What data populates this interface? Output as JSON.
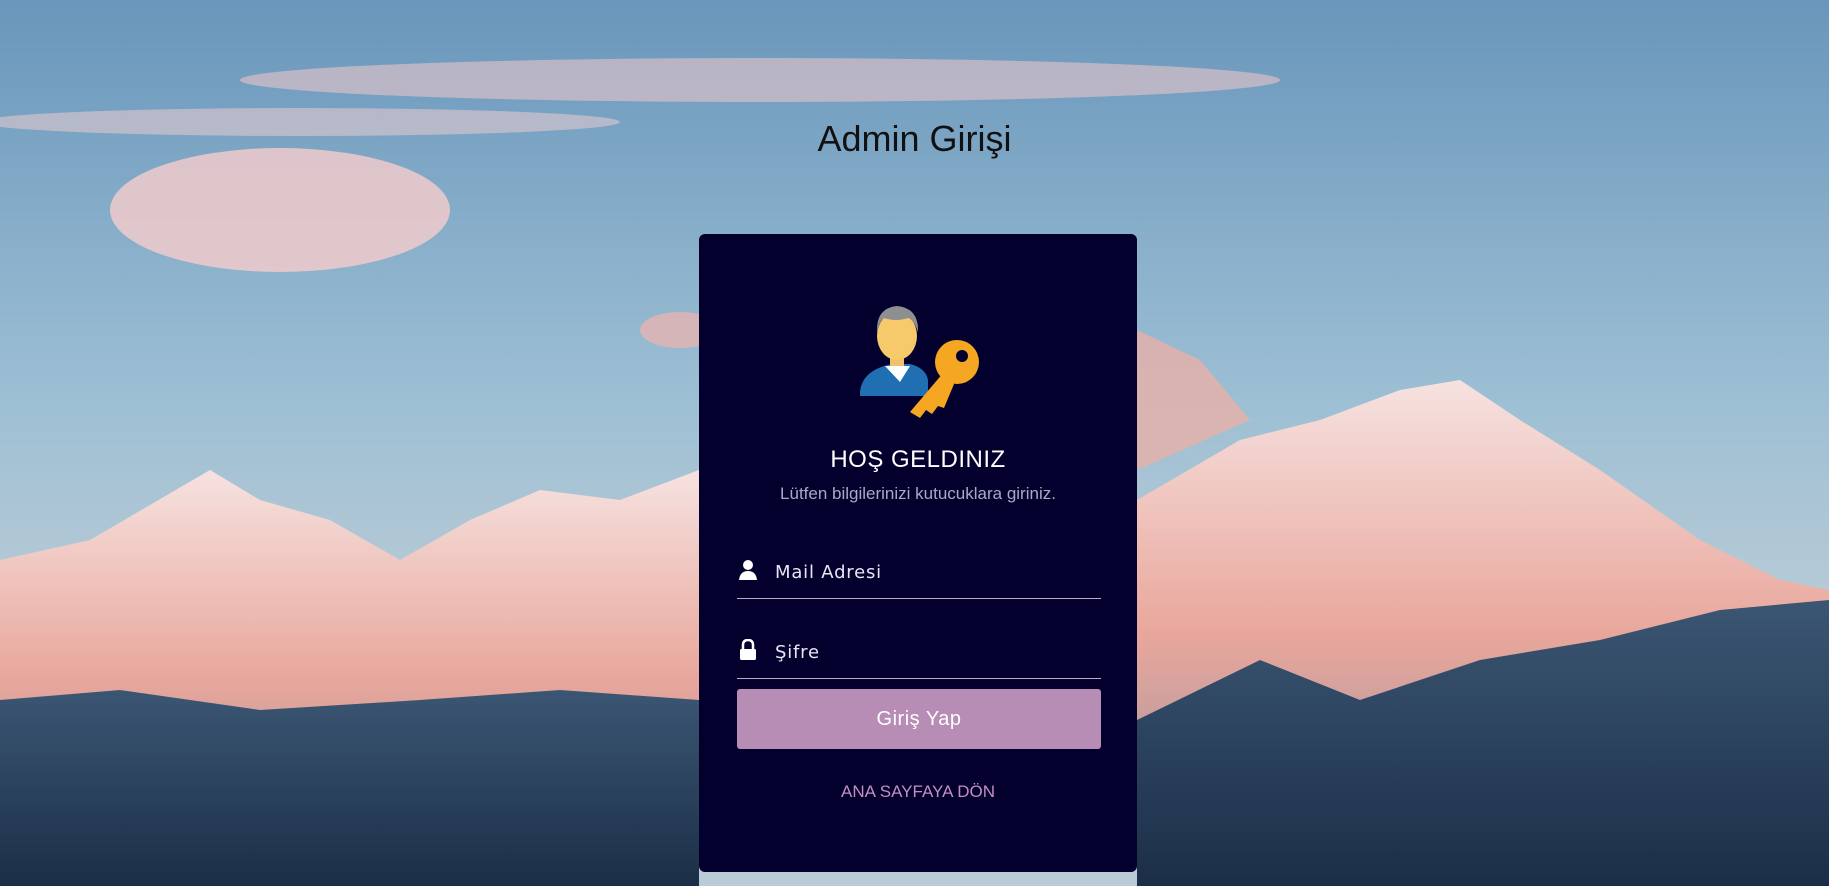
{
  "page": {
    "title": "Admin Girişi"
  },
  "login_card": {
    "welcome": "HOŞ GELDINIZ",
    "subtitle": "Lütfen bilgilerinizi kutucuklara giriniz.",
    "email_field": {
      "placeholder": "Mail Adresi",
      "value": "",
      "icon": "user-icon"
    },
    "password_field": {
      "placeholder": "Şifre",
      "value": "",
      "icon": "lock-icon"
    },
    "submit_label": "Giriş Yap",
    "home_link_label": "ANA SAYFAYA DÖN",
    "logo_icon": "admin-key-icon"
  },
  "colors": {
    "card_background": "#03002e",
    "button": "#b78db5",
    "link": "#c38ec0",
    "logo_key": "#f5a623",
    "logo_shirt": "#1f6fb2"
  }
}
